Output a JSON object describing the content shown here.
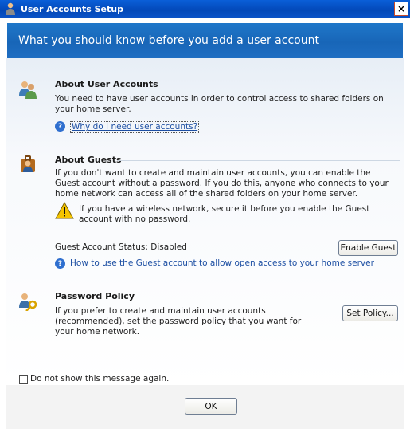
{
  "window": {
    "title": "User Accounts Setup",
    "close_glyph": "×"
  },
  "banner": {
    "heading": "What you should know before you add a user account"
  },
  "sections": {
    "accounts": {
      "icon": "users-icon",
      "title": "About User Accounts",
      "body": "You need to have user accounts in order to control access to shared folders on your home server.",
      "help_link": "Why do I need user accounts?"
    },
    "guests": {
      "icon": "guest-icon",
      "title": "About Guests",
      "body": "If you don't want to create and maintain user accounts, you can enable the Guest account without a password. If you do this, anyone who connects to your home network can access all of the shared folders on your home server.",
      "warning": "If you have a wireless network, secure it before you enable the Guest account with no password.",
      "status": "Guest Account Status: Disabled",
      "enable_button": "Enable Guest",
      "help_link": "How to use the Guest account to allow open access to your home server"
    },
    "policy": {
      "icon": "password-key-icon",
      "title": "Password Policy",
      "body": "If you prefer to create and maintain user accounts (recommended), set the password policy that you want for your home network.",
      "set_button": "Set Policy..."
    }
  },
  "footer": {
    "checkbox_label": "Do not show this message again.",
    "checkbox_checked": false,
    "ok_button": "OK"
  },
  "colors": {
    "title_bar": "#0a5fd8",
    "banner": "#1f77c9",
    "link": "#1d4fa3",
    "warning": "#f5c400"
  }
}
